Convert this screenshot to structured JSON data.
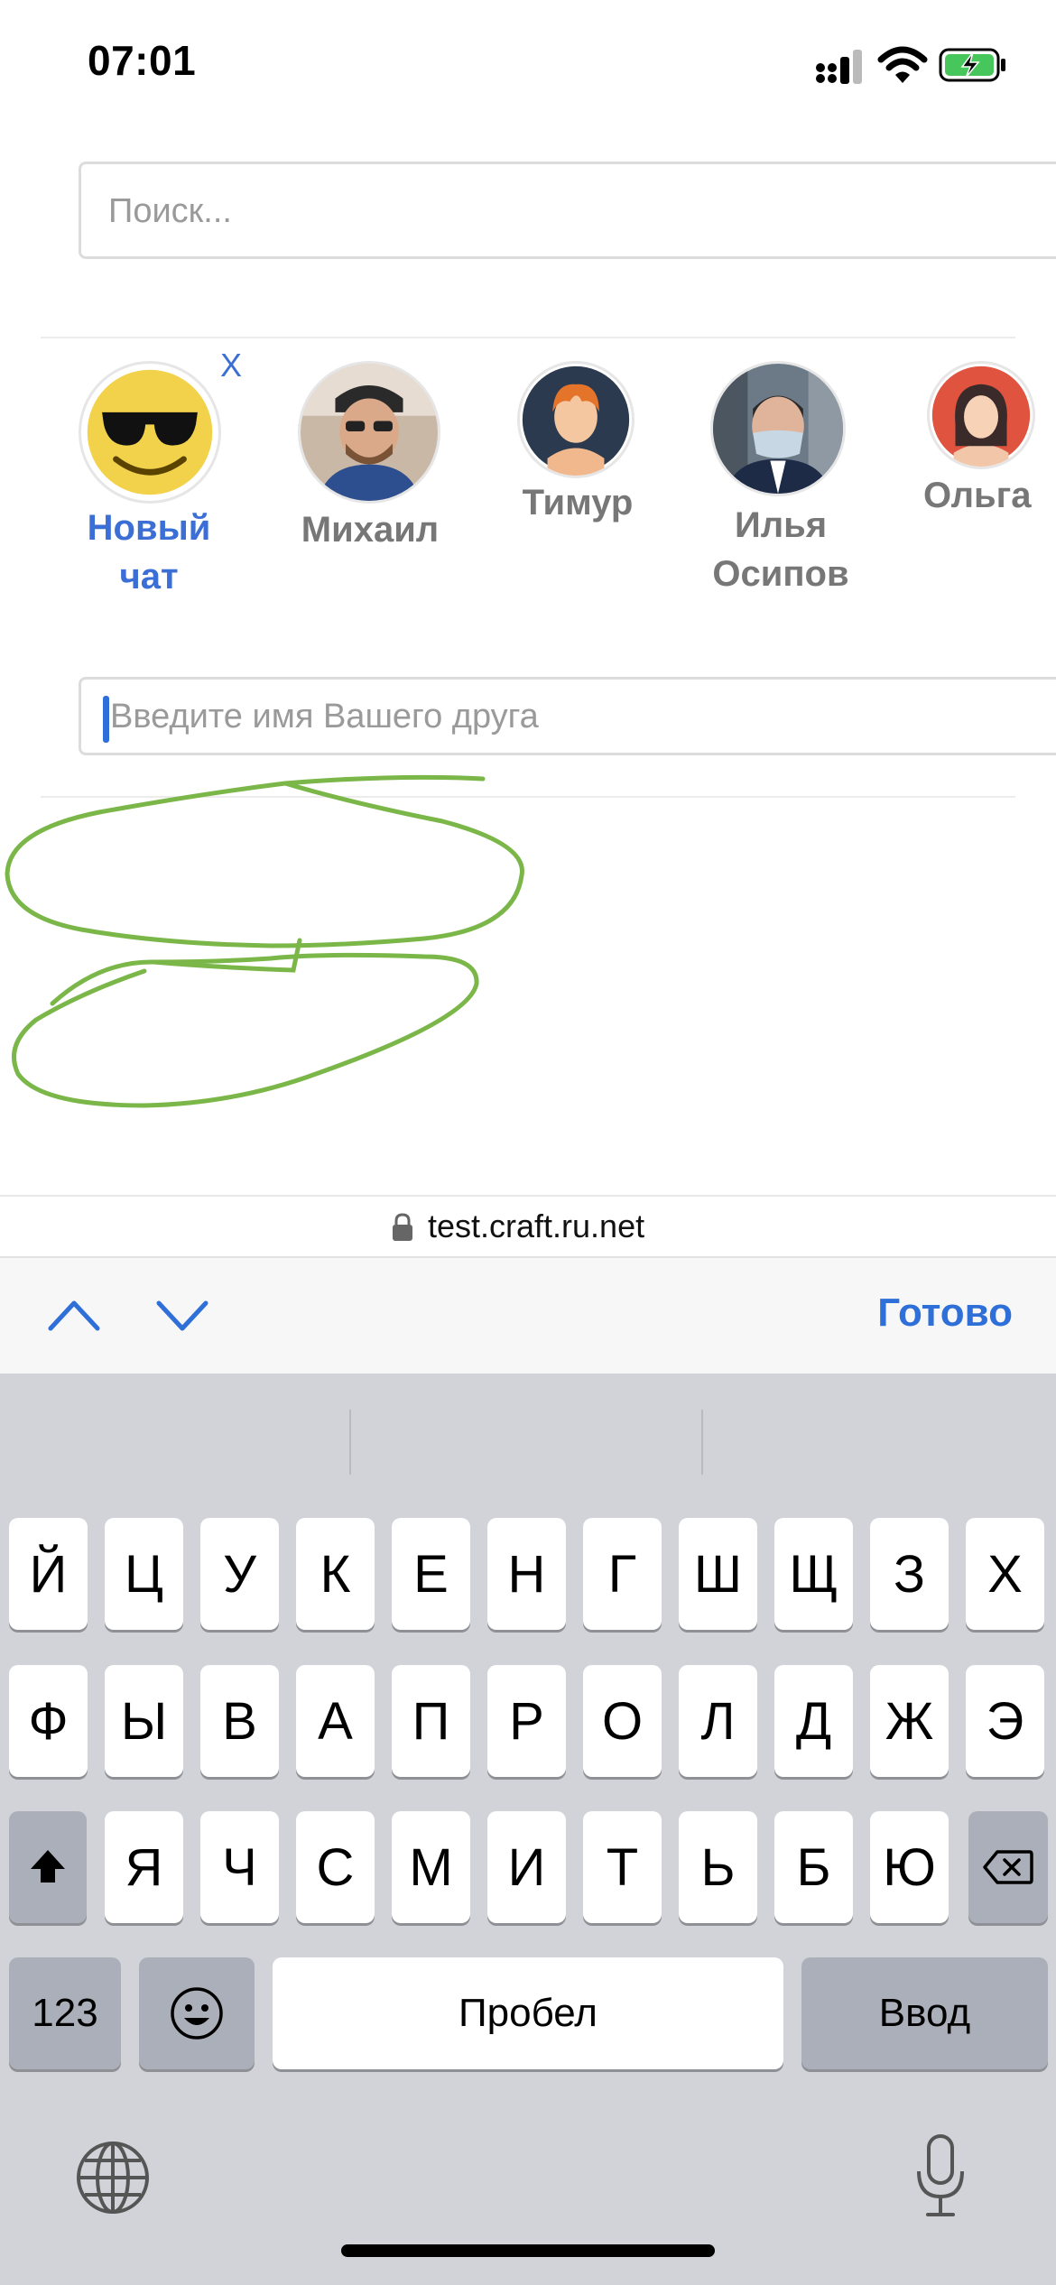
{
  "status_bar": {
    "time": "07:01"
  },
  "search": {
    "placeholder": "Поиск..."
  },
  "contacts": [
    {
      "name_line1": "Новый",
      "name_line2": "чат",
      "avatar": "sunglasses-emoji",
      "color": "#3b6fd6"
    },
    {
      "name": "Михаил",
      "avatar": "photo-man-cap"
    },
    {
      "name": "Тимур",
      "avatar": "cartoon-orange-hair"
    },
    {
      "name_line1": "Илья",
      "name_line2": "Осипов",
      "avatar": "photo-man-mask"
    },
    {
      "name": "Ольга",
      "avatar": "cartoon-woman-dark-hair"
    }
  ],
  "new_chat": {
    "close_label": "X"
  },
  "friend_input": {
    "placeholder": "Введите имя Вашего друга"
  },
  "browser": {
    "url": "test.craft.ru.net"
  },
  "toolbar": {
    "done_label": "Готово"
  },
  "keyboard": {
    "row1": [
      "Й",
      "Ц",
      "У",
      "К",
      "Е",
      "Н",
      "Г",
      "Ш",
      "Щ",
      "З",
      "Х"
    ],
    "row2": [
      "Ф",
      "Ы",
      "В",
      "А",
      "П",
      "Р",
      "О",
      "Л",
      "Д",
      "Ж",
      "Э"
    ],
    "row3": [
      "Я",
      "Ч",
      "С",
      "М",
      "И",
      "Т",
      "Ь",
      "Б",
      "Ю"
    ],
    "numbers_label": "123",
    "space_label": "Пробел",
    "return_label": "Ввод"
  },
  "colors": {
    "accent": "#2f6fd8",
    "annotation": "#7ab648",
    "keyboard_bg": "#d1d3d9"
  }
}
